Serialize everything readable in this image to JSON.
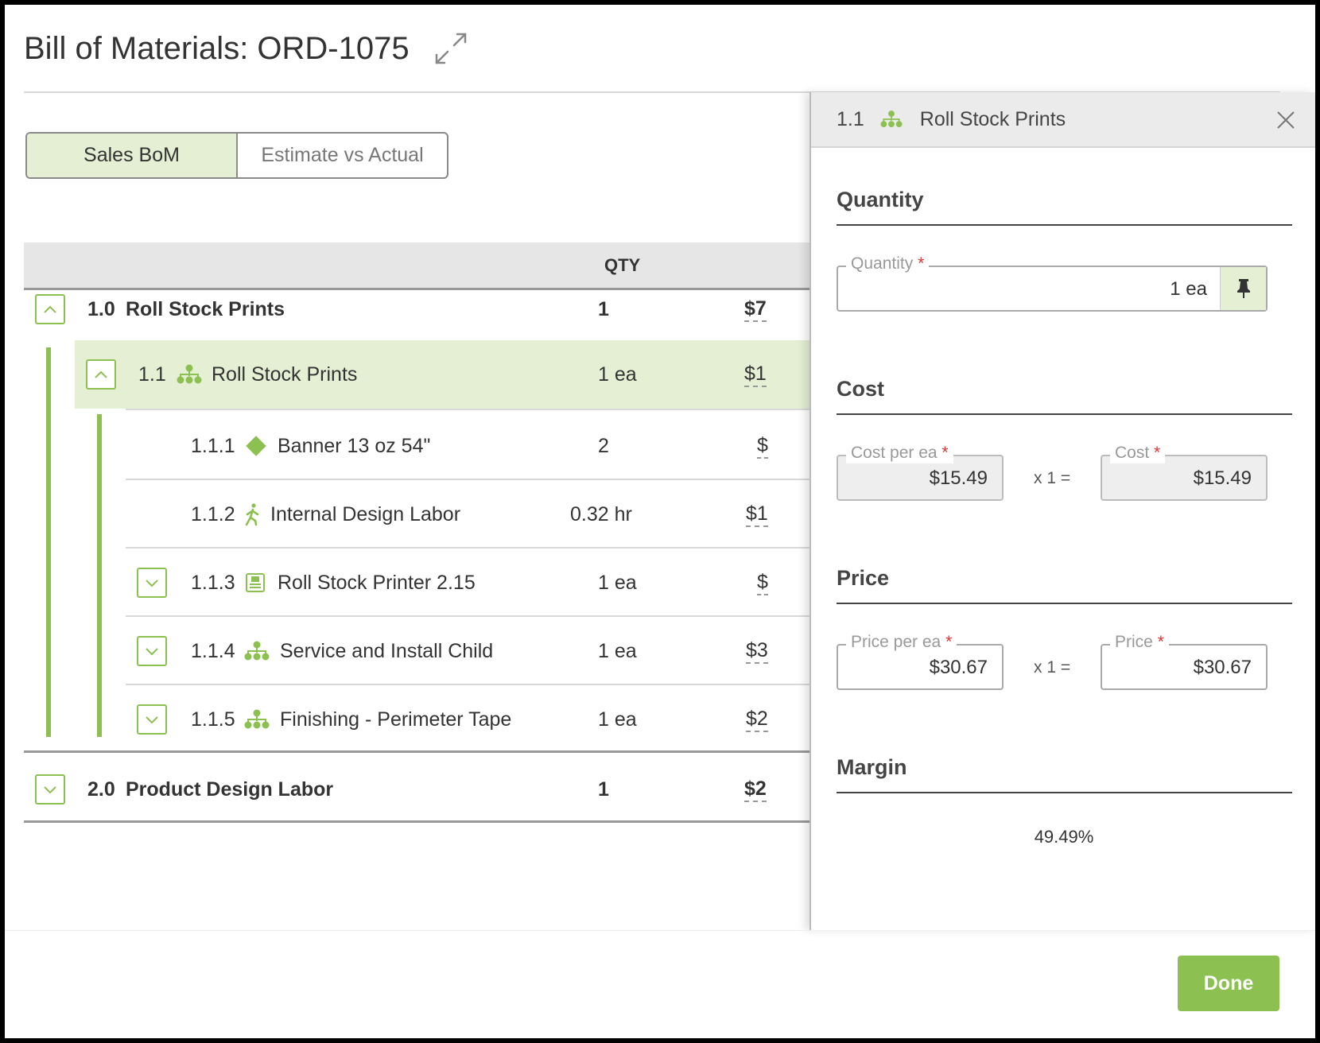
{
  "dialog": {
    "title": "Bill of Materials: ORD-1075"
  },
  "toggle": {
    "sales_label": "Sales BoM",
    "estimate_label": "Estimate vs Actual"
  },
  "table": {
    "qty_header": "QTY",
    "rows": [
      {
        "num": "1.0",
        "label": "Roll Stock Prints",
        "qty": "1",
        "cost": "$7"
      },
      {
        "num": "1.1",
        "label": "Roll Stock Prints",
        "qty": "1 ea",
        "cost": "$1"
      },
      {
        "num": "1.1.1",
        "label": "Banner 13 oz 54\"",
        "qty": "2",
        "cost": "$"
      },
      {
        "num": "1.1.2",
        "label": "Internal Design Labor",
        "qty": "0.32 hr",
        "cost": "$1"
      },
      {
        "num": "1.1.3",
        "label": "Roll Stock Printer 2.15",
        "qty": "1 ea",
        "cost": "$"
      },
      {
        "num": "1.1.4",
        "label": "Service and Install Child",
        "qty": "1 ea",
        "cost": "$3"
      },
      {
        "num": "1.1.5",
        "label": "Finishing - Perimeter Tape",
        "qty": "1 ea",
        "cost": "$2"
      },
      {
        "num": "2.0",
        "label": "Product Design Labor",
        "qty": "1",
        "cost": "$2"
      }
    ]
  },
  "panel": {
    "num": "1.1",
    "title": "Roll Stock Prints",
    "quantity": {
      "section": "Quantity",
      "field_label": "Quantity",
      "required": "*",
      "value": "1 ea"
    },
    "cost": {
      "section": "Cost",
      "per_label": "Cost per ea",
      "per_value": "$15.49",
      "mult": "x 1 =",
      "total_label": "Cost",
      "total_value": "$15.49"
    },
    "price": {
      "section": "Price",
      "per_label": "Price per ea",
      "per_value": "$30.67",
      "mult": "x 1 =",
      "total_label": "Price",
      "total_value": "$30.67"
    },
    "margin": {
      "section": "Margin",
      "value": "49.49%"
    }
  },
  "footer": {
    "done_label": "Done"
  },
  "colors": {
    "accent": "#8cc152",
    "selected_row": "#e4efd3",
    "required": "#dd3333"
  },
  "icons": {
    "expand": "expand-arrows-icon",
    "hierarchy": "hierarchy-icon",
    "diamond": "diamond-icon",
    "walker": "person-walking-icon",
    "machine": "printer-machine-icon",
    "pin": "pin-icon",
    "close": "close-icon"
  }
}
